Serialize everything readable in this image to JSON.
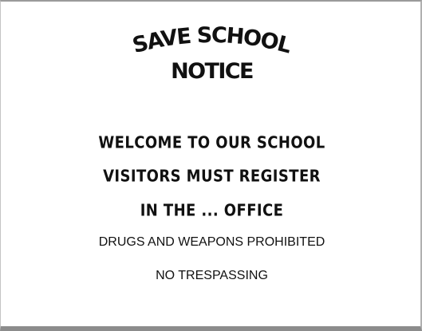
{
  "notice": {
    "title_line1": "SAVE SCHOOL",
    "title_line2": "NOTICE",
    "lines": [
      "WELCOME TO OUR SCHOOL",
      "VISITORS MUST REGISTER",
      "IN THE ... OFFICE",
      "DRUGS AND WEAPONS PROHIBITED",
      "NO TRESPASSING"
    ]
  }
}
